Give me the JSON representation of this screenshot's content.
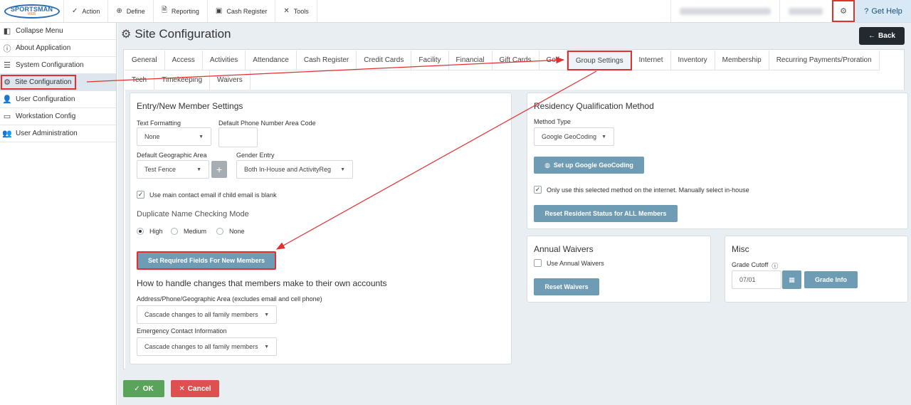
{
  "topbar": {
    "logo_text": "SPORTSMAN",
    "logo_sub": "WEB",
    "nav": [
      {
        "label": "Action",
        "icon": "check-icon"
      },
      {
        "label": "Define",
        "icon": "plus-circle-icon"
      },
      {
        "label": "Reporting",
        "icon": "document-icon"
      },
      {
        "label": "Cash Register",
        "icon": "cash-register-icon"
      },
      {
        "label": "Tools",
        "icon": "tools-icon"
      }
    ],
    "help_label": "Get Help"
  },
  "sidebar": {
    "items": [
      {
        "label": "Collapse Menu",
        "icon": "collapse-icon"
      },
      {
        "label": "About Application",
        "icon": "info-icon"
      },
      {
        "label": "System Configuration",
        "icon": "server-icon"
      },
      {
        "label": "Site Configuration",
        "icon": "gears-icon"
      },
      {
        "label": "User Configuration",
        "icon": "user-gear-icon"
      },
      {
        "label": "Workstation Config",
        "icon": "monitor-icon"
      },
      {
        "label": "User Administration",
        "icon": "users-icon"
      }
    ]
  },
  "page": {
    "title": "Site Configuration",
    "back_label": "Back"
  },
  "tabs": {
    "row1": [
      "General",
      "Access",
      "Activities",
      "Attendance",
      "Cash Register",
      "Credit Cards",
      "Facility",
      "Financial",
      "Gift Cards",
      "Golf",
      "Group Settings",
      "Internet",
      "Inventory",
      "Membership",
      "Recurring Payments/Proration"
    ],
    "row2": [
      "Tech",
      "Timekeeping",
      "Waivers"
    ],
    "active": "Group Settings"
  },
  "entry": {
    "title": "Entry/New Member Settings",
    "text_formatting_label": "Text Formatting",
    "text_formatting_value": "None",
    "phone_area_label": "Default Phone Number Area Code",
    "phone_area_value": "",
    "geo_label": "Default Geographic Area",
    "geo_value": "Test Fence",
    "gender_label": "Gender Entry",
    "gender_value": "Both In-House and ActivityReg",
    "email_checkbox_label": "Use main contact email if child email is blank",
    "dup_title": "Duplicate Name Checking Mode",
    "dup_options": [
      "High",
      "Medium",
      "None"
    ],
    "dup_selected": "High",
    "required_btn": "Set Required Fields For New Members",
    "changes_title": "How to handle changes that members make to their own accounts",
    "address_label": "Address/Phone/Geographic Area (excludes email and cell phone)",
    "address_value": "Cascade changes to all family members",
    "emergency_label": "Emergency Contact Information",
    "emergency_value": "Cascade changes to all family members"
  },
  "residency": {
    "title": "Residency Qualification Method",
    "method_label": "Method Type",
    "method_value": "Google GeoCoding",
    "setup_btn": "Set up Google GeoCoding",
    "internet_checkbox_label": "Only use this selected method on the internet. Manually select in-house",
    "reset_btn": "Reset Resident Status for ALL Members"
  },
  "waivers": {
    "title": "Annual Waivers",
    "checkbox_label": "Use Annual Waivers",
    "reset_btn": "Reset Waivers"
  },
  "misc": {
    "title": "Misc",
    "grade_label": "Grade Cutoff",
    "grade_value": "07/01",
    "grade_info_btn": "Grade Info"
  },
  "footer": {
    "ok_label": "OK",
    "cancel_label": "Cancel"
  },
  "colors": {
    "accent_button": "#6e9cb4",
    "highlight_red": "#e03030",
    "ok_green": "#5aa35a",
    "cancel_red": "#de5050",
    "back_dark": "#222a30"
  }
}
